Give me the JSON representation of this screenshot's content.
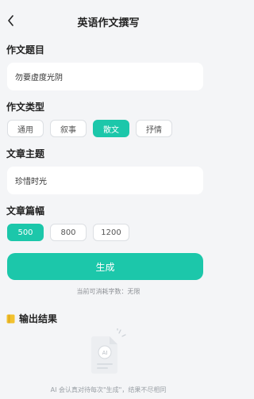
{
  "header": {
    "title": "英语作文撰写"
  },
  "topic": {
    "label": "作文题目",
    "value": "勿要虚度光阴"
  },
  "type": {
    "label": "作文类型",
    "options": [
      "通用",
      "叙事",
      "散文",
      "抒情"
    ],
    "selected": "散文"
  },
  "theme": {
    "label": "文章主题",
    "value": "珍惜时光"
  },
  "length": {
    "label": "文章篇幅",
    "options": [
      "500",
      "800",
      "1200"
    ],
    "selected": "500"
  },
  "generate": {
    "label": "生成"
  },
  "consume_hint": "当前可消耗字数：无限",
  "output": {
    "label": "输出结果"
  },
  "empty": {
    "text": "AI 会认真对待每次\"生成\"，结果不尽相同"
  },
  "colors": {
    "accent": "#1cc7aa",
    "background": "#f4f5f7"
  },
  "icons": {
    "back": "chevron-left-icon",
    "output": "book-icon",
    "empty": "ai-document-icon"
  }
}
